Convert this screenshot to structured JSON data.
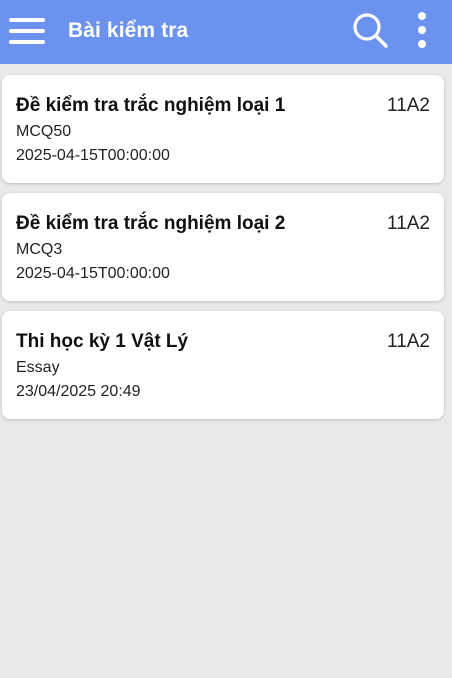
{
  "app_bar": {
    "title": "Bài kiểm tra",
    "menu_icon": "hamburger-menu-icon",
    "search_icon": "search-icon",
    "more_icon": "more-vertical-icon",
    "background_color": "#6b92ee",
    "text_color": "#ffffff"
  },
  "tests": [
    {
      "title": "Đề kiểm tra trắc nghiệm loại 1",
      "class_name": "11A2",
      "type": "MCQ50",
      "date": "2025-04-15T00:00:00"
    },
    {
      "title": "Đề kiểm tra trắc nghiệm loại 2",
      "class_name": "11A2",
      "type": "MCQ3",
      "date": "2025-04-15T00:00:00"
    },
    {
      "title": "Thi học kỳ 1 Vật Lý",
      "class_name": "11A2",
      "type": "Essay",
      "date": "23/04/2025 20:49"
    }
  ]
}
